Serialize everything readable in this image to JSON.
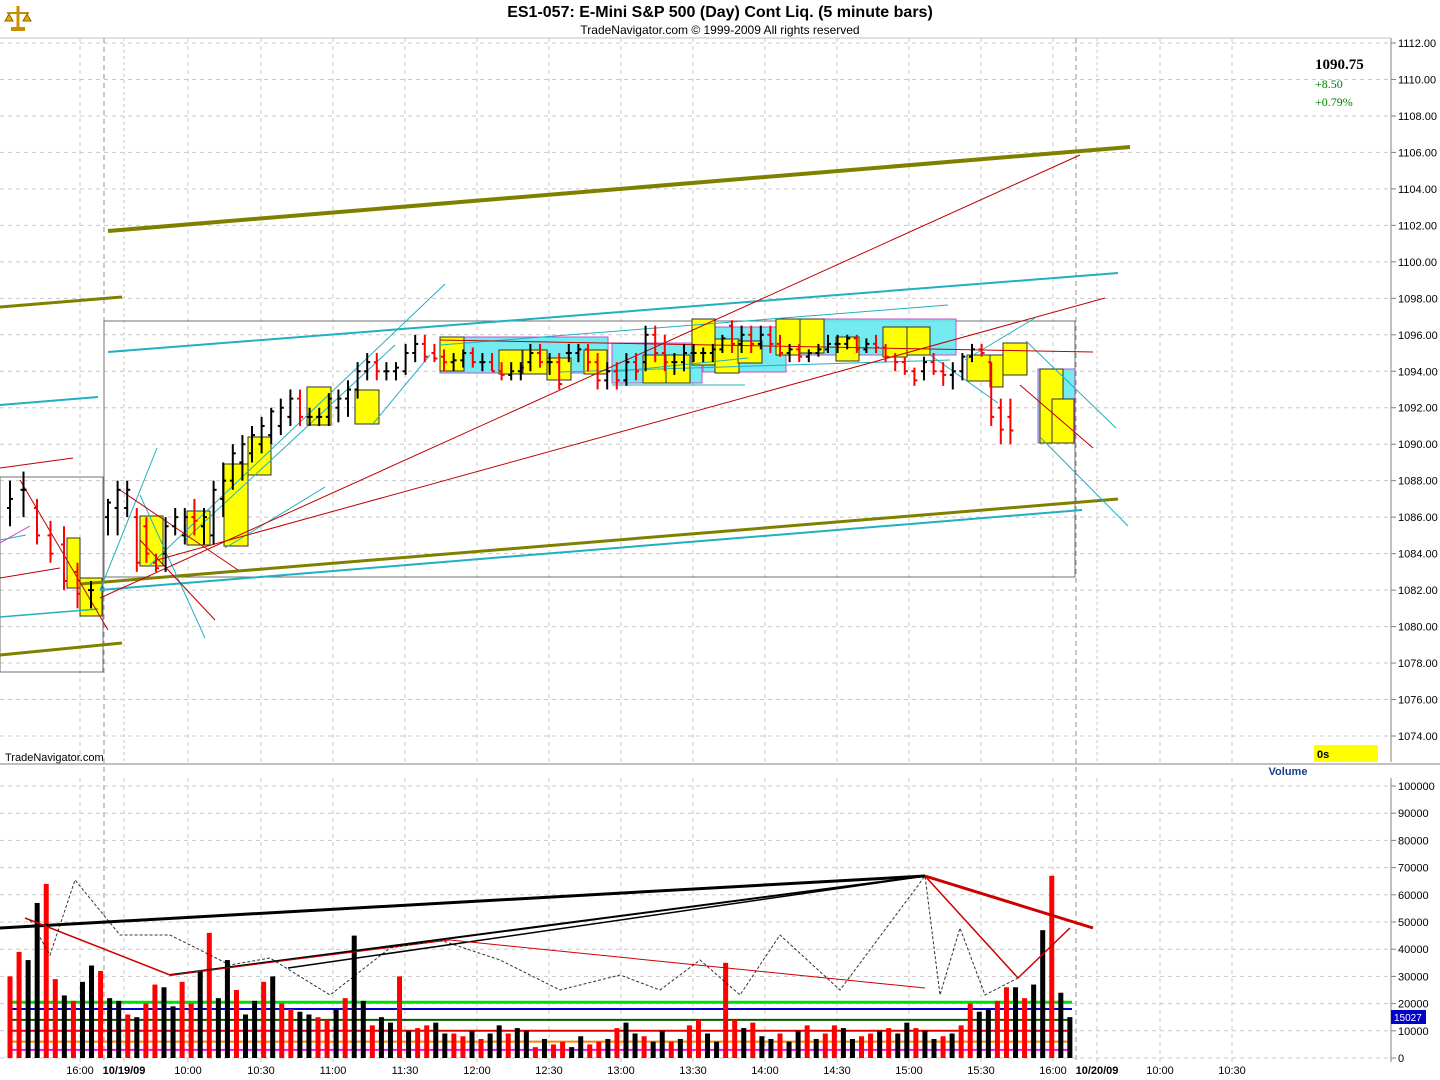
{
  "header": {
    "title": "ES1-057:  E-Mini S&P 500 (Day) Cont Liq.  (5 minute bars)",
    "subtitle": "TradeNavigator.com © 1999-2009 All rights reserved"
  },
  "quote": {
    "last": "1090.75",
    "change": "+8.50",
    "change_pct": "+0.79%",
    "last_color": "#000000",
    "change_color": "#008000"
  },
  "watermark": "TradeNavigator.com",
  "timer": {
    "label": "0s",
    "color": "#ffff00"
  },
  "volume_panel": {
    "title": "Volume",
    "current_label": "15027",
    "label_bg": "#0000cc"
  },
  "icons": {
    "logo": "scales-logo-icon"
  },
  "colors": {
    "up_bar": "#000000",
    "down_bar": "#ff0000",
    "trend_olive": "#808000",
    "trend_cyan": "#20b0c0",
    "trend_red": "#c00000",
    "box_yellow": "#ffff00",
    "box_cyan": "#66e8f0",
    "vol_green": "#00e000",
    "vol_blue": "#0000cc",
    "vol_orange": "#ff8000",
    "vol_magenta": "#ff00ff"
  },
  "chart_data": [
    {
      "type": "candlestick",
      "title": "ES1-057:  E-Mini S&P 500 (Day) Cont Liq.  (5 minute bars)",
      "y_ticks": [
        "1112.00",
        "1110.00",
        "1108.00",
        "1106.00",
        "1104.00",
        "1102.00",
        "1100.00",
        "1098.00",
        "1096.00",
        "1094.00",
        "1092.00",
        "1090.00",
        "1088.00",
        "1086.00",
        "1084.00",
        "1082.00",
        "1080.00",
        "1078.00",
        "1076.00",
        "1074.00"
      ],
      "ylim": [
        1072.5,
        1112.5
      ],
      "x_ticks": [
        "16:00",
        "10/19/09",
        "10:00",
        "10:30",
        "11:00",
        "11:30",
        "12:00",
        "12:30",
        "13:00",
        "13:30",
        "14:00",
        "14:30",
        "15:00",
        "15:30",
        "16:00",
        "10/20/09",
        "10:00",
        "10:30"
      ],
      "grid": true,
      "last_price": 1090.75,
      "bars": [
        {
          "o": 1086.5,
          "h": 1088.0,
          "l": 1085.5,
          "c": 1087.0
        },
        {
          "o": 1087.5,
          "h": 1088.5,
          "l": 1086.0,
          "c": 1087.5
        },
        {
          "o": 1086.5,
          "h": 1087.0,
          "l": 1084.5,
          "c": 1085.0
        },
        {
          "o": 1085.0,
          "h": 1085.8,
          "l": 1083.5,
          "c": 1084.0
        },
        {
          "o": 1084.5,
          "h": 1085.5,
          "l": 1082.0,
          "c": 1082.5
        },
        {
          "o": 1083.0,
          "h": 1083.5,
          "l": 1081.0,
          "c": 1081.8
        },
        {
          "o": 1082.0,
          "h": 1082.5,
          "l": 1081.0,
          "c": 1082.0
        },
        {
          "o": 1086.0,
          "h": 1087.0,
          "l": 1085.0,
          "c": 1086.8
        },
        {
          "o": 1086.5,
          "h": 1088.0,
          "l": 1085.0,
          "c": 1087.5
        },
        {
          "o": 1086.5,
          "h": 1088.0,
          "l": 1086.0,
          "c": 1087.5
        },
        {
          "o": 1086.0,
          "h": 1086.5,
          "l": 1083.0,
          "c": 1083.5
        },
        {
          "o": 1085.5,
          "h": 1086.0,
          "l": 1083.5,
          "c": 1084.0
        },
        {
          "o": 1083.5,
          "h": 1084.0,
          "l": 1083.0,
          "c": 1083.2
        },
        {
          "o": 1084.0,
          "h": 1086.0,
          "l": 1083.0,
          "c": 1085.5
        },
        {
          "o": 1085.5,
          "h": 1086.5,
          "l": 1085.0,
          "c": 1086.0
        },
        {
          "o": 1085.0,
          "h": 1086.5,
          "l": 1084.5,
          "c": 1086.0
        },
        {
          "o": 1086.0,
          "h": 1087.0,
          "l": 1085.0,
          "c": 1085.8
        },
        {
          "o": 1085.5,
          "h": 1086.5,
          "l": 1084.5,
          "c": 1086.0
        },
        {
          "o": 1085.0,
          "h": 1088.0,
          "l": 1084.5,
          "c": 1087.5
        },
        {
          "o": 1087.0,
          "h": 1089.0,
          "l": 1086.0,
          "c": 1088.0
        },
        {
          "o": 1088.0,
          "h": 1090.0,
          "l": 1087.5,
          "c": 1089.5
        },
        {
          "o": 1089.0,
          "h": 1090.5,
          "l": 1088.0,
          "c": 1090.0
        },
        {
          "o": 1089.5,
          "h": 1091.0,
          "l": 1089.0,
          "c": 1090.5
        },
        {
          "o": 1090.0,
          "h": 1091.5,
          "l": 1089.5,
          "c": 1091.0
        },
        {
          "o": 1090.5,
          "h": 1092.0,
          "l": 1090.0,
          "c": 1091.8
        },
        {
          "o": 1091.0,
          "h": 1092.5,
          "l": 1090.5,
          "c": 1092.0
        },
        {
          "o": 1091.5,
          "h": 1093.0,
          "l": 1091.0,
          "c": 1092.5
        },
        {
          "o": 1092.5,
          "h": 1093.0,
          "l": 1091.0,
          "c": 1091.5
        },
        {
          "o": 1091.5,
          "h": 1092.0,
          "l": 1091.0,
          "c": 1091.5
        },
        {
          "o": 1091.5,
          "h": 1092.0,
          "l": 1091.0,
          "c": 1091.5
        },
        {
          "o": 1091.5,
          "h": 1092.8,
          "l": 1091.0,
          "c": 1092.5
        },
        {
          "o": 1092.0,
          "h": 1093.0,
          "l": 1091.2,
          "c": 1092.5
        },
        {
          "o": 1092.5,
          "h": 1093.5,
          "l": 1091.5,
          "c": 1093.0
        },
        {
          "o": 1093.0,
          "h": 1094.5,
          "l": 1092.5,
          "c": 1094.0
        },
        {
          "o": 1094.0,
          "h": 1095.0,
          "l": 1093.5,
          "c": 1094.5
        },
        {
          "o": 1094.5,
          "h": 1095.0,
          "l": 1093.5,
          "c": 1094.0
        },
        {
          "o": 1094.0,
          "h": 1094.5,
          "l": 1093.5,
          "c": 1094.0
        },
        {
          "o": 1094.0,
          "h": 1094.5,
          "l": 1093.5,
          "c": 1094.2
        },
        {
          "o": 1094.0,
          "h": 1095.5,
          "l": 1093.8,
          "c": 1095.0
        },
        {
          "o": 1095.0,
          "h": 1096.0,
          "l": 1094.5,
          "c": 1095.5
        },
        {
          "o": 1095.5,
          "h": 1096.0,
          "l": 1094.5,
          "c": 1094.8
        },
        {
          "o": 1095.0,
          "h": 1095.5,
          "l": 1094.5,
          "c": 1094.7
        },
        {
          "o": 1094.8,
          "h": 1095.2,
          "l": 1094.0,
          "c": 1094.5
        },
        {
          "o": 1094.5,
          "h": 1095.0,
          "l": 1094.0,
          "c": 1094.6
        },
        {
          "o": 1094.6,
          "h": 1095.2,
          "l": 1094.2,
          "c": 1095.0
        },
        {
          "o": 1095.0,
          "h": 1095.3,
          "l": 1094.2,
          "c": 1094.5
        },
        {
          "o": 1094.5,
          "h": 1095.0,
          "l": 1094.0,
          "c": 1094.5
        },
        {
          "o": 1094.5,
          "h": 1095.0,
          "l": 1094.0,
          "c": 1094.0
        },
        {
          "o": 1094.0,
          "h": 1094.5,
          "l": 1093.5,
          "c": 1093.8
        },
        {
          "o": 1093.8,
          "h": 1094.5,
          "l": 1093.5,
          "c": 1094.0
        },
        {
          "o": 1094.0,
          "h": 1094.5,
          "l": 1093.5,
          "c": 1094.2
        },
        {
          "o": 1094.5,
          "h": 1095.5,
          "l": 1094.0,
          "c": 1095.0
        },
        {
          "o": 1095.0,
          "h": 1095.5,
          "l": 1094.2,
          "c": 1094.5
        },
        {
          "o": 1094.5,
          "h": 1095.0,
          "l": 1093.8,
          "c": 1094.5
        },
        {
          "o": 1094.5,
          "h": 1095.0,
          "l": 1093.0,
          "c": 1093.3
        },
        {
          "o": 1095.0,
          "h": 1095.5,
          "l": 1094.5,
          "c": 1095.0
        },
        {
          "o": 1095.0,
          "h": 1095.5,
          "l": 1094.5,
          "c": 1095.2
        },
        {
          "o": 1095.2,
          "h": 1095.5,
          "l": 1094.0,
          "c": 1094.5
        },
        {
          "o": 1094.5,
          "h": 1095.0,
          "l": 1093.0,
          "c": 1093.5
        },
        {
          "o": 1093.5,
          "h": 1094.5,
          "l": 1093.0,
          "c": 1094.0
        },
        {
          "o": 1094.0,
          "h": 1094.5,
          "l": 1093.0,
          "c": 1093.5
        },
        {
          "o": 1093.5,
          "h": 1095.0,
          "l": 1093.2,
          "c": 1094.5
        },
        {
          "o": 1094.5,
          "h": 1095.0,
          "l": 1093.5,
          "c": 1094.0
        },
        {
          "o": 1094.5,
          "h": 1096.5,
          "l": 1094.0,
          "c": 1096.0
        },
        {
          "o": 1096.0,
          "h": 1096.5,
          "l": 1094.5,
          "c": 1095.0
        },
        {
          "o": 1095.0,
          "h": 1096.0,
          "l": 1094.0,
          "c": 1094.5
        },
        {
          "o": 1094.5,
          "h": 1095.0,
          "l": 1093.8,
          "c": 1094.5
        },
        {
          "o": 1094.5,
          "h": 1095.5,
          "l": 1094.0,
          "c": 1095.0
        },
        {
          "o": 1095.0,
          "h": 1095.5,
          "l": 1094.5,
          "c": 1095.0
        },
        {
          "o": 1095.0,
          "h": 1095.3,
          "l": 1094.5,
          "c": 1095.0
        },
        {
          "o": 1095.0,
          "h": 1095.5,
          "l": 1094.5,
          "c": 1095.2
        },
        {
          "o": 1095.2,
          "h": 1096.0,
          "l": 1095.0,
          "c": 1095.8
        },
        {
          "o": 1096.5,
          "h": 1096.8,
          "l": 1095.0,
          "c": 1095.5
        },
        {
          "o": 1095.5,
          "h": 1096.5,
          "l": 1095.0,
          "c": 1096.0
        },
        {
          "o": 1096.0,
          "h": 1096.5,
          "l": 1095.0,
          "c": 1095.5
        },
        {
          "o": 1095.5,
          "h": 1096.5,
          "l": 1095.2,
          "c": 1096.0
        },
        {
          "o": 1096.0,
          "h": 1096.5,
          "l": 1095.0,
          "c": 1095.5
        },
        {
          "o": 1095.5,
          "h": 1096.0,
          "l": 1094.8,
          "c": 1095.0
        },
        {
          "o": 1095.0,
          "h": 1095.5,
          "l": 1094.5,
          "c": 1095.2
        },
        {
          "o": 1095.2,
          "h": 1095.5,
          "l": 1094.5,
          "c": 1094.8
        },
        {
          "o": 1094.8,
          "h": 1095.2,
          "l": 1094.5,
          "c": 1095.0
        },
        {
          "o": 1095.0,
          "h": 1095.5,
          "l": 1094.8,
          "c": 1095.2
        },
        {
          "o": 1095.2,
          "h": 1096.0,
          "l": 1095.0,
          "c": 1095.5
        },
        {
          "o": 1095.5,
          "h": 1096.0,
          "l": 1095.0,
          "c": 1095.5
        },
        {
          "o": 1095.5,
          "h": 1096.0,
          "l": 1095.2,
          "c": 1095.8
        },
        {
          "o": 1095.8,
          "h": 1096.0,
          "l": 1095.0,
          "c": 1095.2
        },
        {
          "o": 1095.2,
          "h": 1095.8,
          "l": 1095.0,
          "c": 1095.5
        },
        {
          "o": 1095.5,
          "h": 1096.0,
          "l": 1095.0,
          "c": 1095.3
        },
        {
          "o": 1095.3,
          "h": 1095.5,
          "l": 1094.5,
          "c": 1094.8
        },
        {
          "o": 1094.8,
          "h": 1095.0,
          "l": 1094.0,
          "c": 1094.5
        },
        {
          "o": 1094.5,
          "h": 1094.8,
          "l": 1093.8,
          "c": 1094.0
        },
        {
          "o": 1094.0,
          "h": 1094.2,
          "l": 1093.2,
          "c": 1093.5
        },
        {
          "o": 1094.0,
          "h": 1094.8,
          "l": 1093.5,
          "c": 1094.5
        },
        {
          "o": 1094.5,
          "h": 1095.0,
          "l": 1093.8,
          "c": 1094.0
        },
        {
          "o": 1094.0,
          "h": 1094.5,
          "l": 1093.2,
          "c": 1093.8
        },
        {
          "o": 1093.8,
          "h": 1094.5,
          "l": 1093.0,
          "c": 1094.0
        },
        {
          "o": 1094.0,
          "h": 1095.0,
          "l": 1093.5,
          "c": 1094.8
        },
        {
          "o": 1094.8,
          "h": 1095.5,
          "l": 1094.5,
          "c": 1095.2
        },
        {
          "o": 1095.2,
          "h": 1095.5,
          "l": 1094.8,
          "c": 1095.0
        },
        {
          "o": 1094.5,
          "h": 1094.5,
          "l": 1091.0,
          "c": 1091.5
        },
        {
          "o": 1092.0,
          "h": 1092.5,
          "l": 1090.0,
          "c": 1090.8
        },
        {
          "o": 1091.5,
          "h": 1092.5,
          "l": 1090.0,
          "c": 1090.75
        }
      ]
    },
    {
      "type": "bar",
      "title": "Volume",
      "y_ticks": [
        "100000",
        "90000",
        "80000",
        "70000",
        "60000",
        "50000",
        "40000",
        "30000",
        "20000",
        "10000",
        "0"
      ],
      "ylim": [
        0,
        100000
      ],
      "current_value": 15027,
      "values": [
        30000,
        39000,
        36000,
        57000,
        64000,
        29000,
        23000,
        21000,
        28000,
        34000,
        32000,
        22000,
        21000,
        16000,
        15000,
        20000,
        27000,
        26000,
        19000,
        28000,
        20000,
        32000,
        46000,
        22000,
        36000,
        25000,
        16000,
        21000,
        28000,
        30000,
        20000,
        18000,
        17000,
        16000,
        15000,
        14000,
        18000,
        22000,
        45000,
        21000,
        12000,
        15000,
        13000,
        30000,
        10000,
        11000,
        12000,
        13000,
        9000,
        9000,
        8000,
        10000,
        7000,
        9000,
        12000,
        9000,
        11000,
        10000,
        4000,
        7000,
        5000,
        6000,
        4000,
        8000,
        5000,
        6000,
        7000,
        11000,
        13000,
        9000,
        8000,
        6000,
        10000,
        6000,
        7000,
        12000,
        14000,
        9000,
        6000,
        35000,
        14000,
        11000,
        13000,
        8000,
        7000,
        9000,
        6000,
        10000,
        12000,
        7000,
        9000,
        12000,
        11000,
        7000,
        8000,
        9000,
        10000,
        11000,
        9000,
        13000,
        11000,
        10000,
        7000,
        8000,
        9000,
        12000,
        20000,
        17000,
        18000,
        21000,
        26000,
        26000,
        22000,
        27000,
        47000,
        67000,
        24000,
        15027
      ],
      "colors_pattern": "red for down bars, black for up bars"
    }
  ]
}
